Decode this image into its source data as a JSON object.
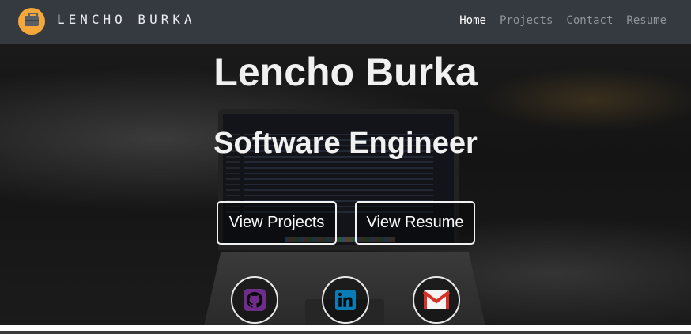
{
  "navbar": {
    "brand_icon": "briefcase-icon",
    "brand_name": "LENCHO BURKA",
    "links": [
      {
        "label": "Home",
        "active": true
      },
      {
        "label": "Projects",
        "active": false
      },
      {
        "label": "Contact",
        "active": false
      },
      {
        "label": "Resume",
        "active": false
      }
    ]
  },
  "hero": {
    "title": "Lencho Burka",
    "subtitle": "Software Engineer",
    "buttons": {
      "projects_label": "View Projects",
      "resume_label": "View Resume"
    },
    "social": [
      {
        "icon": "github-icon",
        "color": "#6e2d8a"
      },
      {
        "icon": "linkedin-icon",
        "color": "#0a7cb8"
      },
      {
        "icon": "gmail-icon",
        "color": "#d93025"
      }
    ]
  },
  "colors": {
    "navbar_bg": "#343a40",
    "brand_accent": "#f6a739",
    "nav_inactive": "#8f959b"
  }
}
